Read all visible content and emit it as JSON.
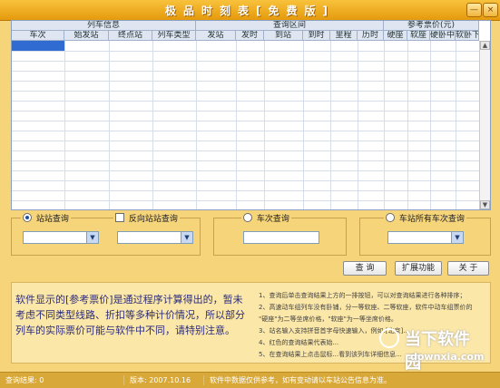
{
  "window": {
    "title": "极品时刻表[免费版]",
    "minimize_glyph": "—",
    "close_glyph": "×"
  },
  "grid": {
    "group_headers": [
      "列车信息",
      "查询区间",
      "参考票价(元)"
    ],
    "columns": [
      "车次",
      "始发站",
      "终点站",
      "列车类型",
      "发站",
      "发时",
      "到站",
      "到时",
      "里程",
      "历时",
      "硬座",
      "软座",
      "硬卧中",
      "软卧下"
    ],
    "rows": []
  },
  "panels": [
    {
      "label": "站站查询",
      "control": "radio",
      "checked": true,
      "selects": [
        "",
        ""
      ]
    },
    {
      "label": "反向站站查询",
      "control": "checkbox",
      "checked": false
    },
    {
      "label": "车次查询",
      "control": "radio",
      "checked": false,
      "input_value": ""
    },
    {
      "label": "车站所有车次查询",
      "control": "radio",
      "checked": false,
      "select_value": ""
    }
  ],
  "buttons": {
    "query": "查 询",
    "extend": "扩展功能",
    "about": "关 于"
  },
  "notice": "软件显示的[参考票价]是通过程序计算得出的，暂未考虑不同类型线路、折扣等多种计价情况，所以部分列车的实际票价可能与软件中不同，请特别注意。",
  "tips": [
    "1、查询后单击查询结果上方的一排按钮，可以对查询结果进行各种排序；",
    "2、高速动车组列车没有卧铺，分一等软座、二等软座，软件中动车组票价的",
    "\"硬座\"为二等坐席价格，\"软座\"为一等坐席价格。",
    "3、站名输入支持拼音首字母快速输入，例如:[北京]...",
    "4、红色的查询结果代表始...",
    "5、在查询结果上点击鼠标...看到该列车详细信息..."
  ],
  "status": {
    "result": "查询结果: 0",
    "version": "版本: 2007.10.16",
    "message": "软件中数据仅供参考，如有变动请以车站公告信息为准。"
  },
  "watermark": {
    "name": "当下软件园",
    "domain": "downxia.com"
  }
}
